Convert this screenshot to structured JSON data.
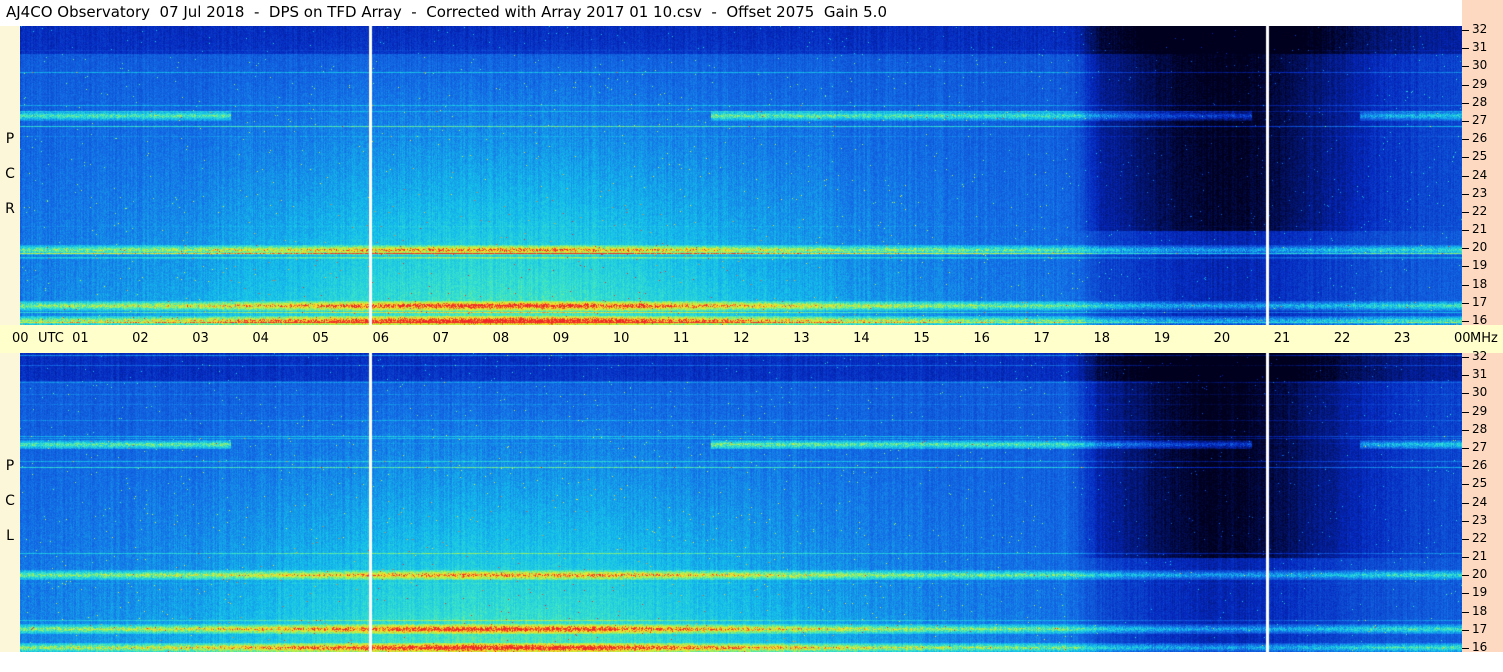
{
  "title": "AJ4CO Observatory  07 Jul 2018  -  DPS on TFD Array  -  Corrected with Array 2017 01 10.csv  -  Offset 2075  Gain 5.0",
  "colors": {
    "utc_axis_bg": "#ffffcc",
    "freq_axis_bg": "#fcd9c0",
    "pol_strip_bg": "#fcf7d9"
  },
  "chart_data": [
    {
      "type": "heatmap",
      "panel": "RCP",
      "pol_label_letters": [
        "P",
        "C",
        "R"
      ],
      "x_label": "UTC",
      "x_tick_labels": [
        "00",
        "01",
        "02",
        "03",
        "04",
        "05",
        "06",
        "07",
        "08",
        "09",
        "10",
        "11",
        "12",
        "13",
        "14",
        "15",
        "16",
        "17",
        "18",
        "19",
        "20",
        "21",
        "22",
        "23",
        "00"
      ],
      "x_range_hours": [
        0,
        24
      ],
      "y_unit": "MHz",
      "y_ticks": [
        16,
        17,
        18,
        19,
        20,
        21,
        22,
        23,
        24,
        25,
        26,
        27,
        28,
        29,
        30,
        31,
        32
      ],
      "y_range_mhz": [
        16,
        32
      ],
      "data_gaps_utc": [
        5.82,
        20.75
      ],
      "quiet_interval_utc": [
        17.45,
        20.55
      ],
      "strong_bands_mhz": [
        27.2,
        17.0,
        16.2,
        20.0
      ],
      "description_levels": "intensity colormap blue (low) to cyan/green/yellow/red (high)"
    },
    {
      "type": "heatmap",
      "panel": "LCP",
      "pol_label_letters": [
        "P",
        "C",
        "L"
      ],
      "x_range_hours": [
        0,
        24
      ],
      "y_unit": "MHz",
      "y_ticks": [
        16,
        17,
        18,
        19,
        20,
        21,
        22,
        23,
        24,
        25,
        26,
        27,
        28,
        29,
        30,
        31,
        32
      ],
      "y_range_mhz": [
        16,
        32
      ],
      "data_gaps_utc": [
        5.82,
        20.75
      ],
      "quiet_interval_utc": [
        17.45,
        20.55
      ],
      "strong_bands_mhz": [
        27.1,
        17.2,
        16.2,
        20.1
      ]
    }
  ]
}
